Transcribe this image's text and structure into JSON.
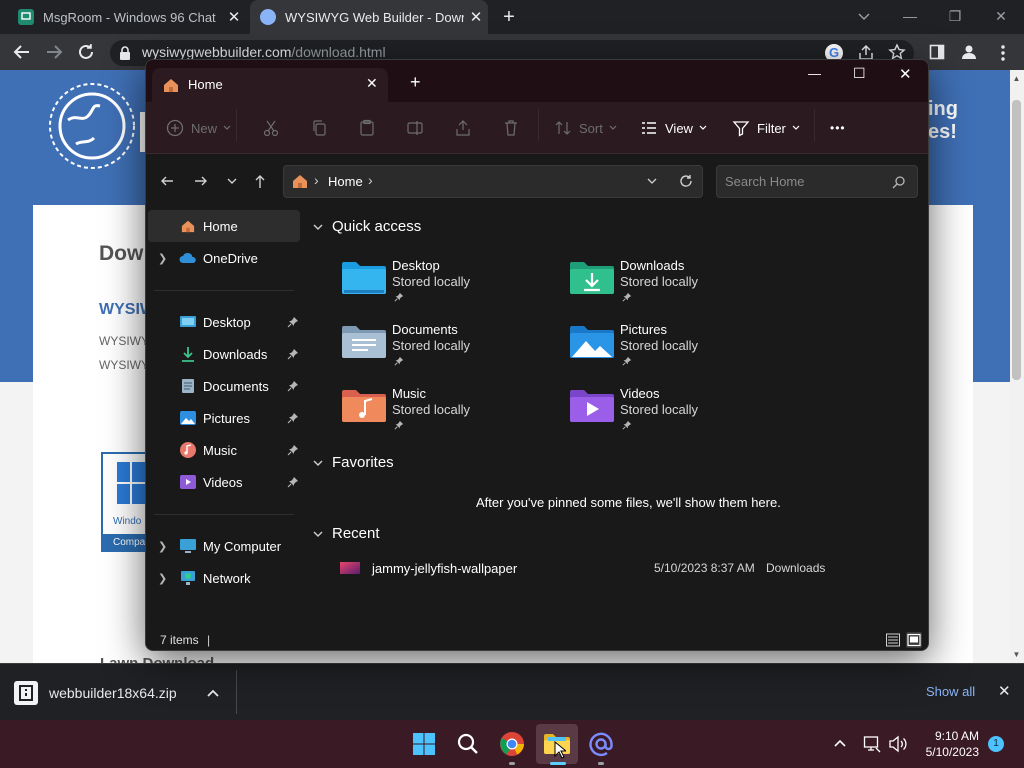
{
  "browser": {
    "tabs": [
      {
        "title": "MsgRoom - Windows 96 Chat",
        "close": "✕"
      },
      {
        "title": "WYSIWYG Web Builder - Downlo",
        "close": "✕"
      }
    ],
    "new_tab": "+",
    "url_domain": "wysiwygwebbuilder.com",
    "url_path": "/download.html",
    "window_controls": {
      "minimize": "—",
      "restore": "❐",
      "close": "✕"
    },
    "partial_text": {
      "hero_line1": "ing",
      "hero_line2": "es!",
      "heading": "Dow",
      "subheading": "WYSIWY",
      "line1": "WYSIWY",
      "line2": "WYSIWY",
      "badge1": "Windo",
      "badge2": "Compa",
      "below": "Lawn Download"
    }
  },
  "download_bar": {
    "file": "webbuilder18x64.zip",
    "show_all": "Show all",
    "close": "✕"
  },
  "explorer": {
    "tab_title": "Home",
    "tab_close": "✕",
    "new_tab": "+",
    "window_controls": {
      "minimize": "—",
      "maximize": "☐",
      "close": "✕"
    },
    "commands": {
      "new": "New",
      "sort": "Sort",
      "view": "View",
      "filter": "Filter",
      "more": "•••"
    },
    "address": {
      "location": "Home",
      "separator": "›"
    },
    "search_placeholder": "Search Home",
    "nav": {
      "home": "Home",
      "onedrive": "OneDrive",
      "desktop": "Desktop",
      "downloads": "Downloads",
      "documents": "Documents",
      "pictures": "Pictures",
      "music": "Music",
      "videos": "Videos",
      "my_computer": "My Computer",
      "network": "Network"
    },
    "quick_access": {
      "title": "Quick access",
      "items": [
        {
          "name": "Desktop",
          "sub": "Stored locally"
        },
        {
          "name": "Downloads",
          "sub": "Stored locally"
        },
        {
          "name": "Documents",
          "sub": "Stored locally"
        },
        {
          "name": "Pictures",
          "sub": "Stored locally"
        },
        {
          "name": "Music",
          "sub": "Stored locally"
        },
        {
          "name": "Videos",
          "sub": "Stored locally"
        }
      ]
    },
    "favorites": {
      "title": "Favorites",
      "empty": "After you've pinned some files, we'll show them here."
    },
    "recent": {
      "title": "Recent",
      "items": [
        {
          "name": "jammy-jellyfish-wallpaper",
          "date": "5/10/2023 8:37 AM",
          "location": "Downloads"
        }
      ]
    },
    "status": {
      "count": "7 items",
      "cursor": "|"
    }
  },
  "taskbar": {
    "time": "9:10 AM",
    "date": "5/10/2023",
    "notifications": "1",
    "tray_chevron": "^"
  },
  "colors": {
    "taskbar": "#3a1a24",
    "explorer_titlebar": "#1f0f14",
    "explorer_cmdbar": "#2b1a1f",
    "page_hero": "#3f6fb5"
  }
}
